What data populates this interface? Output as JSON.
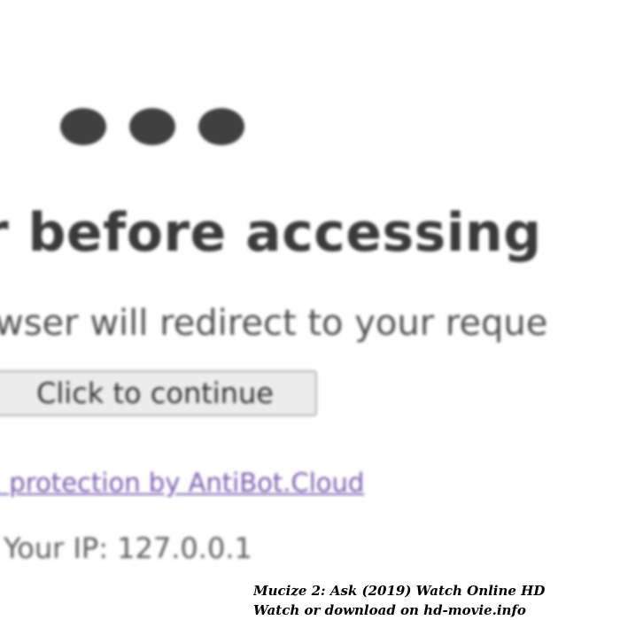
{
  "loading_indicator": {
    "icon": "three-dots-loading-icon",
    "dot_color": "#404040"
  },
  "challenge": {
    "headline": "r before accessing",
    "subline": "wser will redirect to your reque",
    "continue_button_label": "Click to continue",
    "protection_link": ". protection by AntiBot.Cloud",
    "ip_text": "Your IP: 127.0.0.1"
  },
  "watermark": {
    "line1": "Mucize 2: Ask (2019) Watch Online HD",
    "line2": "Watch or download on hd-movie.info"
  },
  "colors": {
    "background": "#ffffff",
    "text_dark": "#3a3a3a",
    "link": "#7b5cb0",
    "button_bg": "#ececec"
  }
}
